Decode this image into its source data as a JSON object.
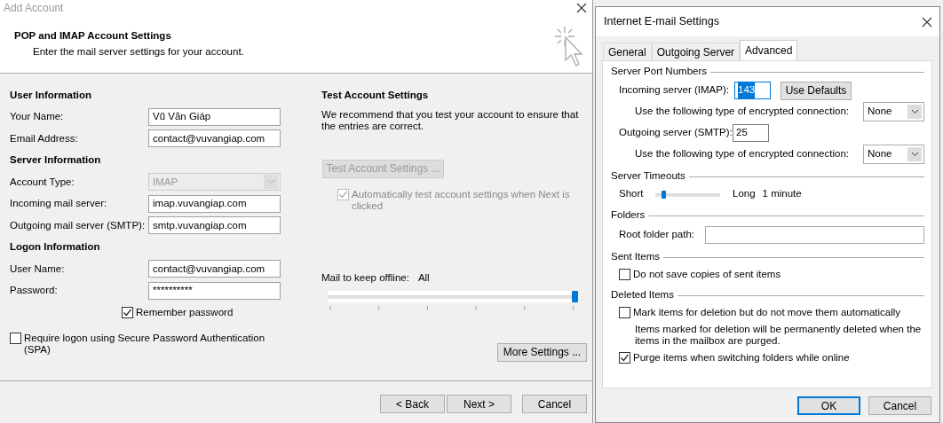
{
  "main_window": {
    "title": "Add Account",
    "header": {
      "title": "POP and IMAP Account Settings",
      "subtitle": "Enter the mail server settings for your account."
    },
    "sections": [
      {
        "heading": "User Information",
        "fields": [
          {
            "kind": "text",
            "label": "Your Name:",
            "value": "Vũ Văn Giáp"
          },
          {
            "kind": "text",
            "label": "Email Address:",
            "value": "contact@vuvangiap.com"
          }
        ]
      },
      {
        "heading": "Server Information",
        "fields": [
          {
            "kind": "select",
            "label": "Account Type:",
            "value": "IMAP",
            "disabled": true
          },
          {
            "kind": "text",
            "label": "Incoming mail server:",
            "value": "imap.vuvangiap.com"
          },
          {
            "kind": "text",
            "label": "Outgoing mail server (SMTP):",
            "value": "smtp.vuvangiap.com"
          }
        ]
      },
      {
        "heading": "Logon Information",
        "fields": [
          {
            "kind": "text",
            "label": "User Name:",
            "value": "contact@vuvangiap.com"
          },
          {
            "kind": "text",
            "label": "Password:",
            "value": "**********"
          }
        ]
      }
    ],
    "remember_password": {
      "label": "Remember password",
      "checked": true
    },
    "spa": {
      "label": "Require logon using Secure Password Authentication (SPA)",
      "checked": false
    },
    "test": {
      "heading": "Test Account Settings",
      "description": "We recommend that you test your account to ensure that the entries are correct.",
      "button": {
        "label": "Test Account Settings ...",
        "disabled": true
      },
      "auto_test": {
        "label": "Automatically test account settings when Next is clicked",
        "checked": true,
        "disabled": true
      }
    },
    "offline": {
      "label": "Mail to keep offline:",
      "value": "All",
      "level": 1
    },
    "more_settings": "More Settings ...",
    "buttons": [
      "< Back",
      "Next >",
      "Cancel"
    ]
  },
  "dialog": {
    "title": "Internet E-mail Settings",
    "tabs": [
      {
        "label": "General",
        "selected": false
      },
      {
        "label": "Outgoing Server",
        "selected": false
      },
      {
        "label": "Advanced",
        "selected": true
      }
    ],
    "groups": [
      {
        "title": "Server Port Numbers",
        "rows": [
          {
            "kind": "port",
            "label": "Incoming server (IMAP):",
            "value": "143",
            "text_selected": true,
            "button": "Use Defaults"
          },
          {
            "kind": "select",
            "label": "Use the following type of encrypted connection:",
            "value": "None"
          },
          {
            "kind": "port",
            "label": "Outgoing server (SMTP):",
            "value": "25",
            "text_selected": false
          },
          {
            "kind": "select",
            "label": "Use the following type of encrypted connection:",
            "value": "None"
          }
        ]
      },
      {
        "title": "Server Timeouts",
        "rows": [
          {
            "kind": "slider",
            "min_label": "Short",
            "max_label": "Long",
            "reading": "1 minute",
            "level": 0.1
          }
        ]
      },
      {
        "title": "Folders",
        "rows": [
          {
            "kind": "text",
            "label": "Root folder path:"
          }
        ]
      },
      {
        "title": "Sent Items",
        "rows": [
          {
            "kind": "check",
            "label": "Do not save copies of sent items",
            "checked": false
          }
        ]
      },
      {
        "title": "Deleted Items",
        "rows": [
          {
            "kind": "check",
            "label": "Mark items for deletion but do not move them automatically",
            "checked": false
          },
          {
            "kind": "note",
            "label": "Items marked for deletion will be permanently deleted when the items in the mailbox are purged."
          },
          {
            "kind": "check",
            "label": "Purge items when switching folders while online",
            "checked": true
          }
        ]
      }
    ],
    "buttons": [
      {
        "label": "OK",
        "default": true
      },
      {
        "label": "Cancel",
        "default": false
      }
    ]
  }
}
